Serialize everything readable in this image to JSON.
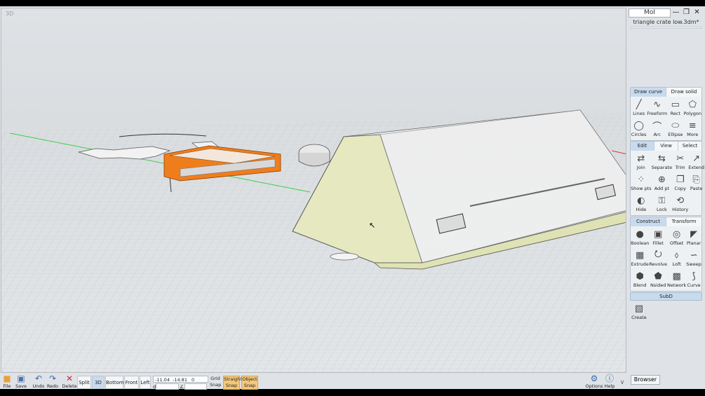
{
  "viewport": {
    "label": "3D"
  },
  "window": {
    "app_name": "MoI",
    "minimize": "—",
    "maximize": "❐",
    "close": "✕",
    "file_name": "triangle crate low.3dm*"
  },
  "draw_tabs": [
    {
      "label": "Draw curve",
      "active": true
    },
    {
      "label": "Draw solid",
      "active": false
    }
  ],
  "draw_tools": [
    {
      "label": "Lines",
      "icon": "line-icon"
    },
    {
      "label": "Freeform",
      "icon": "freeform-icon"
    },
    {
      "label": "Rect",
      "icon": "rect-icon"
    },
    {
      "label": "Polygon",
      "icon": "polygon-icon"
    },
    {
      "label": "Circles",
      "icon": "circle-icon"
    },
    {
      "label": "Arc",
      "icon": "arc-icon"
    },
    {
      "label": "Ellipse",
      "icon": "ellipse-icon"
    },
    {
      "label": "More",
      "icon": "more-icon"
    }
  ],
  "edit_tabs": [
    {
      "label": "Edit",
      "active": true
    },
    {
      "label": "View",
      "active": false
    },
    {
      "label": "Select",
      "active": false
    }
  ],
  "edit_tools": [
    {
      "label": "Join",
      "icon": "join-icon"
    },
    {
      "label": "Separate",
      "icon": "separate-icon"
    },
    {
      "label": "Trim",
      "icon": "trim-icon"
    },
    {
      "label": "Extend",
      "icon": "extend-icon"
    },
    {
      "label": "Show pts",
      "icon": "show-points-icon"
    },
    {
      "label": "Add pt",
      "icon": "add-point-icon"
    },
    {
      "label": "Copy",
      "icon": "copy-icon"
    },
    {
      "label": "Paste",
      "icon": "paste-icon"
    },
    {
      "label": "Hide",
      "icon": "hide-icon"
    },
    {
      "label": "Lock",
      "icon": "lock-icon"
    },
    {
      "label": "History",
      "icon": "history-icon"
    }
  ],
  "construct_tabs": [
    {
      "label": "Construct",
      "active": true
    },
    {
      "label": "Transform",
      "active": false
    }
  ],
  "construct_tools": [
    {
      "label": "Boolean",
      "icon": "boolean-icon"
    },
    {
      "label": "Fillet",
      "icon": "fillet-icon"
    },
    {
      "label": "Offset",
      "icon": "offset-icon"
    },
    {
      "label": "Planar",
      "icon": "planar-icon"
    },
    {
      "label": "Extrude",
      "icon": "extrude-icon"
    },
    {
      "label": "Revolve",
      "icon": "revolve-icon"
    },
    {
      "label": "Loft",
      "icon": "loft-icon"
    },
    {
      "label": "Sweep",
      "icon": "sweep-icon"
    },
    {
      "label": "Blend",
      "icon": "blend-icon"
    },
    {
      "label": "Nsided",
      "icon": "nsided-icon"
    },
    {
      "label": "Network",
      "icon": "network-icon"
    },
    {
      "label": "Curve",
      "icon": "curve-icon"
    }
  ],
  "subd": {
    "label": "SubD",
    "tools": [
      {
        "label": "Create",
        "icon": "subd-create-icon"
      }
    ]
  },
  "bottom": {
    "file": "File",
    "save": "Save",
    "undo": "Undo",
    "redo": "Redo",
    "delete": "Delete",
    "views": [
      {
        "label": "Split",
        "active": false
      },
      {
        "label": "3D",
        "active": true
      },
      {
        "label": "Bottom",
        "active": false
      },
      {
        "label": "Front",
        "active": false
      },
      {
        "label": "Left",
        "active": false
      }
    ],
    "coords": {
      "x": "-11.04",
      "y": "-14.81",
      "z": "0",
      "d_label": "d",
      "angle_label": "∠"
    },
    "grid_snap": "Grid\nSnap",
    "straight_snap": "Straight\nSnap",
    "object_snap": "Object\nSnap",
    "options": "Options",
    "help": "Help",
    "browser": "Browser"
  },
  "colors": {
    "accent_tab": "#c7dbef",
    "snap_on": "#f3c77b",
    "model_fill": "#e6e8c0",
    "selected_orange": "#f07d1c",
    "grid_line": "#c9ced2"
  }
}
